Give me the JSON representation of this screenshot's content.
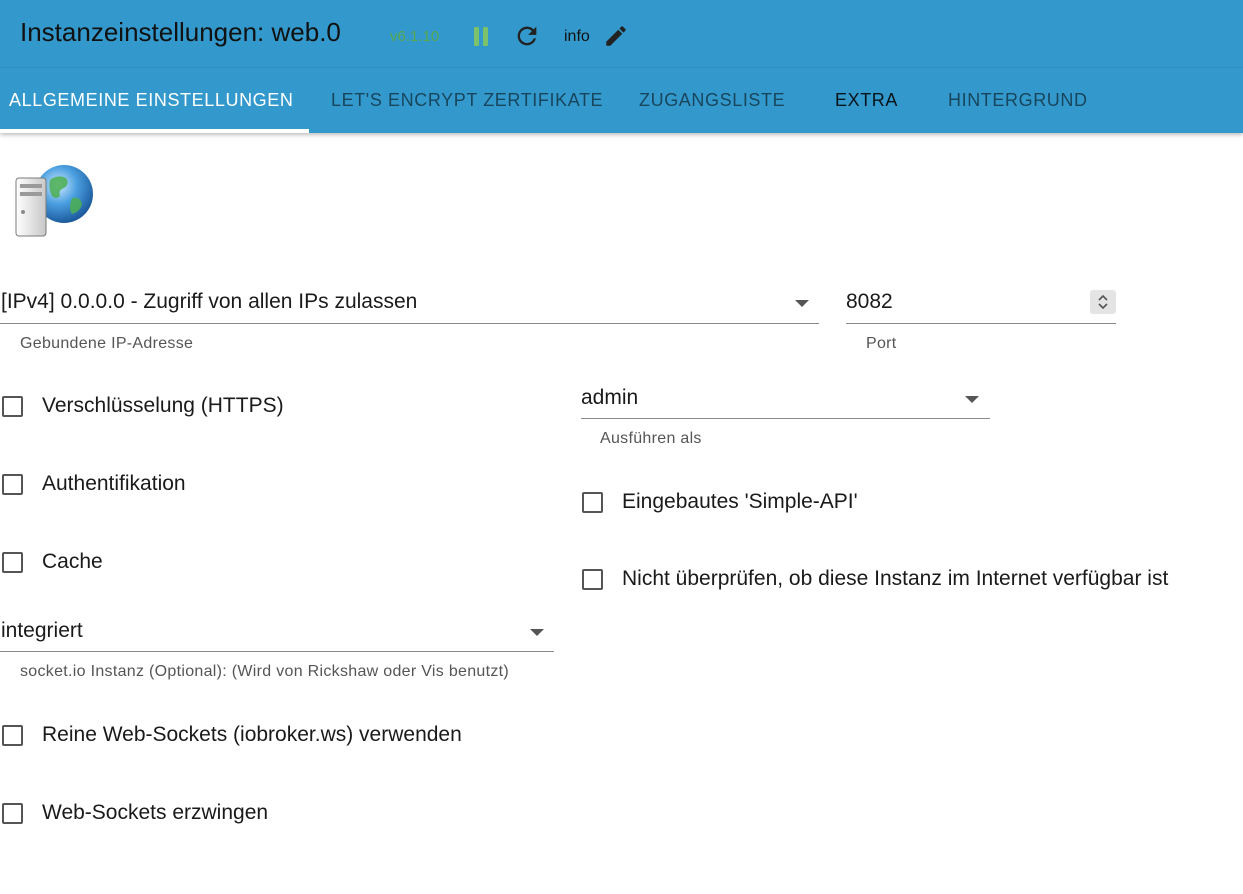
{
  "header": {
    "title": "Instanzeinstellungen: web.0",
    "version": "v6.1.10",
    "info_label": "info"
  },
  "tabs": [
    {
      "label": "ALLGEMEINE EINSTELLUNGEN",
      "active": true
    },
    {
      "label": "LET'S ENCRYPT ZERTIFIKATE",
      "active": false
    },
    {
      "label": "ZUGANGSLISTE",
      "active": false
    },
    {
      "label": "EXTRA",
      "active": false
    },
    {
      "label": "HINTERGRUND",
      "active": false
    }
  ],
  "form": {
    "bind_ip": {
      "value": "[IPv4] 0.0.0.0 - Zugriff von allen IPs zulassen",
      "label": "Gebundene IP-Adresse"
    },
    "port": {
      "value": "8082",
      "label": "Port"
    },
    "run_as": {
      "value": "admin",
      "label": "Ausführen als"
    },
    "socketio": {
      "value": "integriert",
      "label": "socket.io Instanz (Optional): (Wird von Rickshaw oder Vis benutzt)"
    },
    "checkboxes": {
      "https": {
        "label": "Verschlüsselung (HTTPS)",
        "checked": false
      },
      "auth": {
        "label": "Authentifikation",
        "checked": false
      },
      "cache": {
        "label": "Cache",
        "checked": false
      },
      "simple_api": {
        "label": "Eingebautes 'Simple-API'",
        "checked": false
      },
      "no_internet_check": {
        "label": "Nicht überprüfen, ob diese Instanz im Internet verfügbar ist",
        "checked": false
      },
      "pure_ws": {
        "label": "Reine Web-Sockets (iobroker.ws) verwenden",
        "checked": false
      },
      "force_ws": {
        "label": "Web-Sockets erzwingen",
        "checked": false
      }
    }
  },
  "colors": {
    "appbar": "#3399cc",
    "version": "#58a84e",
    "pause": "#7cc26a",
    "active_tab": "#ffffff"
  },
  "icons": {
    "pause": "pause-icon",
    "refresh": "refresh-icon",
    "edit": "pencil-icon",
    "logo": "web-server-globe-icon",
    "dropdown": "caret-down-icon",
    "spinner": "spinner-arrows-icon"
  }
}
